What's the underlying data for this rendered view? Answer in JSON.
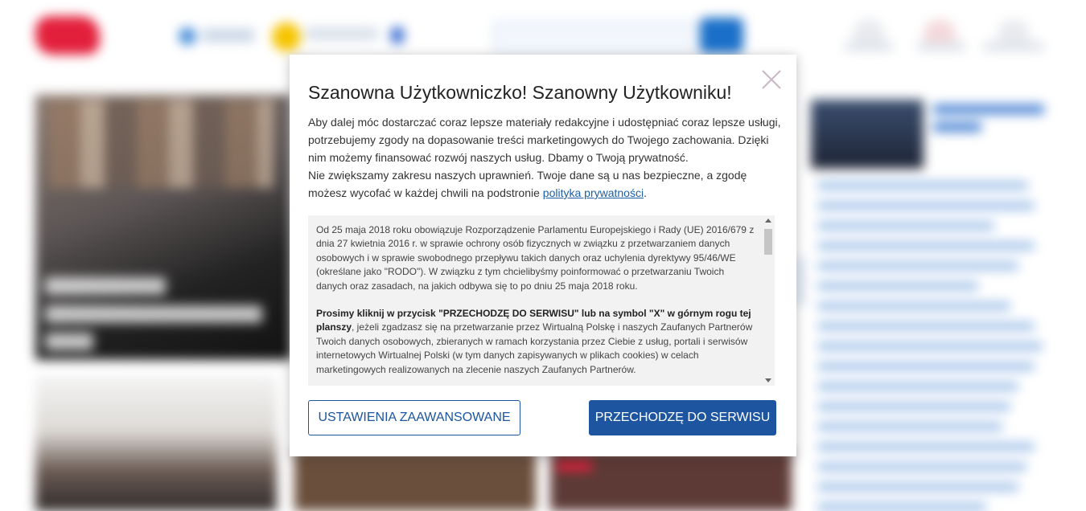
{
  "modal": {
    "title": "Szanowna Użytkowniczko! Szanowny Użytkowniku!",
    "intro_line1": "Aby dalej móc dostarczać coraz lepsze materiały redakcyjne i udostępniać coraz lepsze usługi, potrzebujemy zgody na dopasowanie treści marketingowych do Twojego zachowania. Dzięki nim możemy finansować rozwój naszych usług. Dbamy o Twoją prywatność.",
    "intro_line2_prefix": "Nie zwiększamy zakresu naszych uprawnień. Twoje dane są u nas bezpieczne, a zgodę możesz wycofać w każdej chwili na podstronie ",
    "privacy_link": "polityka prywatności",
    "intro_line2_suffix": ".",
    "scroll": {
      "para1": "Od 25 maja 2018 roku obowiązuje Rozporządzenie Parlamentu Europejskiego i Rady (UE) 2016/679 z dnia 27 kwietnia 2016 r. w sprawie ochrony osób fizycznych w związku z przetwarzaniem danych osobowych i w sprawie swobodnego przepływu takich danych oraz uchylenia dyrektywy 95/46/WE (określane jako \"RODO\"). W związku z tym chcielibyśmy poinformować o przetwarzaniu Twoich danych oraz zasadach, na jakich odbywa się to po dniu 25 maja 2018 roku.",
      "para2_bold": "Prosimy kliknij w przycisk \"PRZECHODZĘ DO SERWISU\" lub na symbol \"X\" w górnym rogu tej planszy",
      "para2_rest": ", jeżeli zgadzasz się na przetwarzanie przez Wirtualną Polskę i naszych Zaufanych Partnerów Twoich danych osobowych, zbieranych w ramach korzystania przez Ciebie z usług, portali i serwisów internetowych Wirtualnej Polski (w tym danych zapisywanych w plikach cookies) w celach marketingowych realizowanych na zlecenie naszych Zaufanych Partnerów."
    },
    "buttons": {
      "advanced": "USTAWIENIA ZAAWANSOWANE",
      "proceed": "PRZECHODZĘ DO SERWISU"
    }
  },
  "colors": {
    "primary": "#1e55a0",
    "link": "#1a5fa8",
    "scroll_bg": "#f2f2f2",
    "brand_red": "#e3203c"
  },
  "icons": {
    "close": "close-icon"
  }
}
